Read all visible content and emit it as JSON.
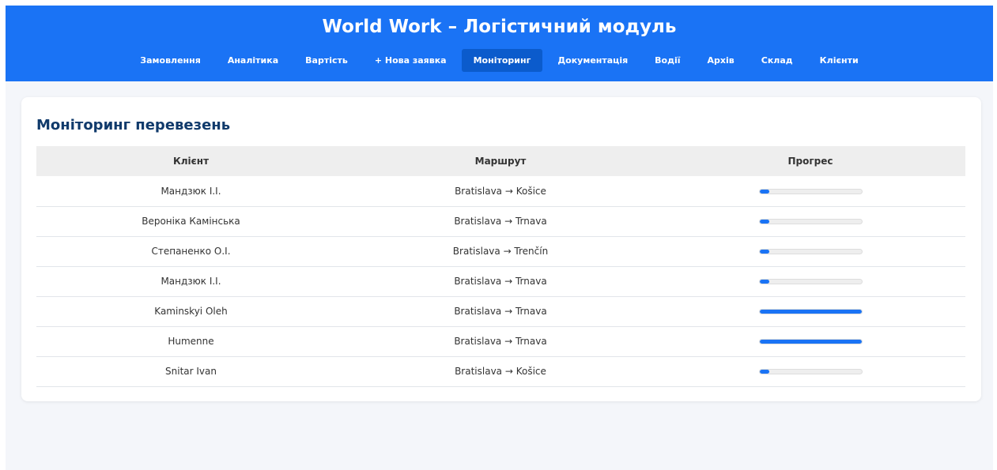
{
  "app": {
    "title": "World Work – Логістичний модуль"
  },
  "nav": {
    "items": [
      {
        "label": "Замовлення",
        "active": false
      },
      {
        "label": "Аналітика",
        "active": false
      },
      {
        "label": "Вартість",
        "active": false
      },
      {
        "label": "+ Нова заявка",
        "active": false
      },
      {
        "label": "Моніторинг",
        "active": true
      },
      {
        "label": "Документація",
        "active": false
      },
      {
        "label": "Водії",
        "active": false
      },
      {
        "label": "Архів",
        "active": false
      },
      {
        "label": "Склад",
        "active": false
      },
      {
        "label": "Клієнти",
        "active": false
      }
    ]
  },
  "monitoring": {
    "title": "Моніторинг перевезень",
    "columns": {
      "client": "Клієнт",
      "route": "Маршрут",
      "progress": "Прогрес"
    },
    "rows": [
      {
        "client": "Мандзюк І.І.",
        "route": "Bratislava → Košice",
        "progress": 10
      },
      {
        "client": "Вероніка Камінська",
        "route": "Bratislava → Trnava",
        "progress": 10
      },
      {
        "client": "Степаненко О.І.",
        "route": "Bratislava → Trenčín",
        "progress": 10
      },
      {
        "client": "Мандзюк І.І.",
        "route": "Bratislava → Trnava",
        "progress": 10
      },
      {
        "client": "Kaminskyi Oleh",
        "route": "Bratislava → Trnava",
        "progress": 100
      },
      {
        "client": "Humenne",
        "route": "Bratislava → Trnava",
        "progress": 100
      },
      {
        "client": "Snitar Ivan",
        "route": "Bratislava → Košice",
        "progress": 10
      }
    ]
  },
  "colors": {
    "primary": "#1a73f5",
    "nav_active": "#0b5bcc",
    "title_text": "#103a6b",
    "page_bg": "#f4f6fa"
  }
}
